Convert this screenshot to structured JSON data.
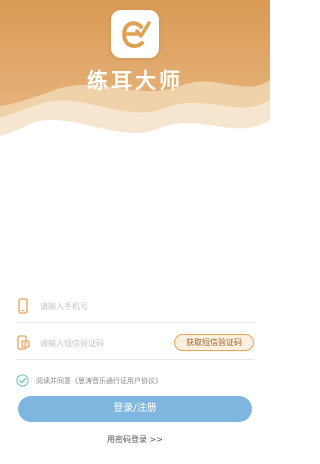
{
  "app": {
    "title": "练耳大师",
    "logo_icon": "ear-check-logo-icon"
  },
  "colors": {
    "header_primary": "#e3a867",
    "header_light": "#f3ddbe",
    "accent": "#e2a55a",
    "button": "#7fb6e0"
  },
  "form": {
    "phone_placeholder": "请输入手机号",
    "phone_icon": "mobile-phone-icon",
    "code_placeholder": "请输入短信验证码",
    "code_icon": "sms-code-icon",
    "get_code_label": "获取短信验证码"
  },
  "agreement": {
    "checked": true,
    "check_icon": "check-circle-icon",
    "prefix": "阅读并同意",
    "link_text": "《思涛音乐通行证用户协议》"
  },
  "actions": {
    "submit_label": "登录/注册",
    "password_login_label": "用密码登录 >>"
  }
}
